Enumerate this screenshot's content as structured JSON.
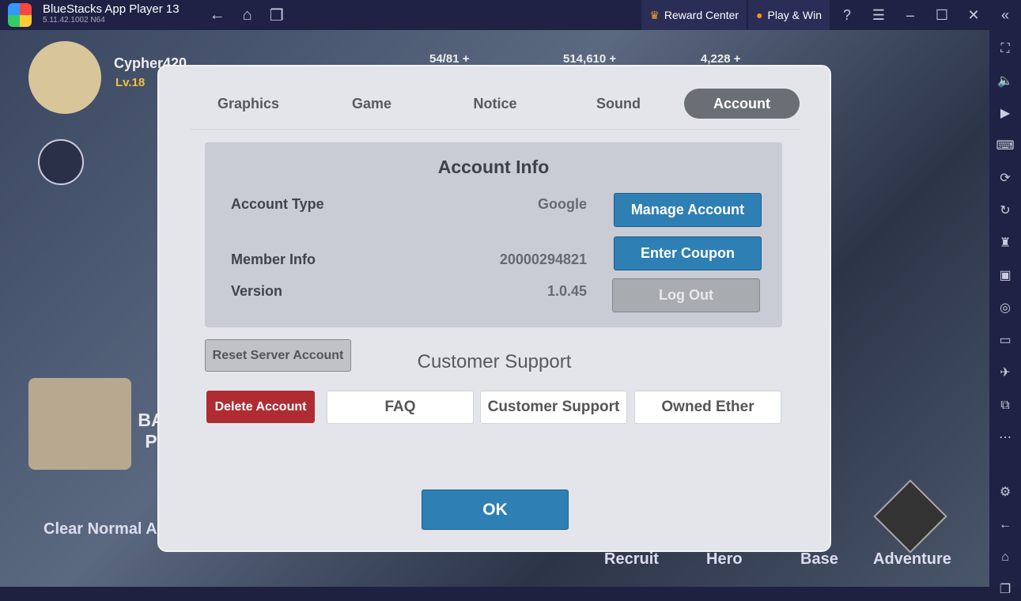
{
  "window": {
    "title": "BlueStacks App Player 13",
    "version": "5.11.42.1002  N64",
    "reward_center": "Reward Center",
    "play_win": "Play & Win"
  },
  "hud": {
    "player": "Cypher420",
    "level": "Lv.18",
    "stamina": "54/81 +",
    "gold": "514,610 +",
    "gems": "4,228 +",
    "quest": "Clear Normal A",
    "banner": "BA\nP"
  },
  "bottom_nav": [
    "Recruit",
    "Hero",
    "Base",
    "Adventure"
  ],
  "dialog": {
    "tabs": [
      {
        "label": "Graphics"
      },
      {
        "label": "Game"
      },
      {
        "label": "Notice"
      },
      {
        "label": "Sound"
      },
      {
        "label": "Account",
        "active": true
      }
    ],
    "account_info": {
      "title": "Account Info",
      "account_type_label": "Account Type",
      "account_type": "Google",
      "member_info_label": "Member Info",
      "member_info": "20000294821",
      "version_label": "Version",
      "version": "1.0.45",
      "manage_account": "Manage Account",
      "enter_coupon": "Enter Coupon",
      "log_out": "Log Out"
    },
    "reset_server_account": "Reset Server Account",
    "customer_support_title": "Customer Support",
    "support_buttons": {
      "delete_account": "Delete Account",
      "faq": "FAQ",
      "customer_support": "Customer Support",
      "owned_ether": "Owned Ether"
    },
    "ok": "OK"
  },
  "colors": {
    "primary_button": "#2e7fb4",
    "danger_button": "#b02c33",
    "active_tab": "#6a6e75"
  }
}
